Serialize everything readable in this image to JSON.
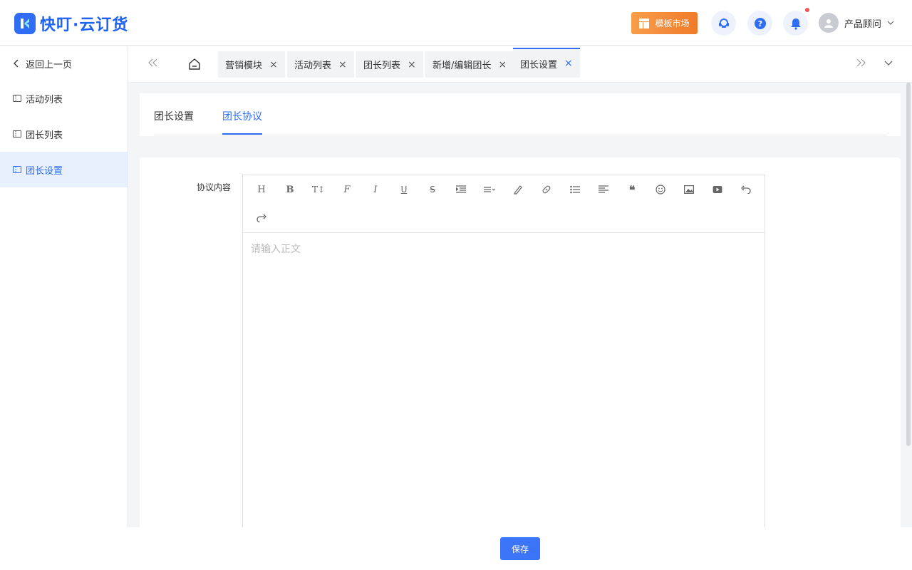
{
  "app": {
    "logo_text": "快叮·云订货"
  },
  "header": {
    "market_label": "模板市场",
    "user_name": "产品顾问"
  },
  "sidebar": {
    "back_label": "返回上一页",
    "items": [
      {
        "label": "活动列表"
      },
      {
        "label": "团长列表"
      },
      {
        "label": "团长设置"
      }
    ]
  },
  "tabs": [
    {
      "label": "营销模块"
    },
    {
      "label": "活动列表"
    },
    {
      "label": "团长列表"
    },
    {
      "label": "新增/编辑团长"
    },
    {
      "label": "团长设置"
    }
  ],
  "subtabs": [
    {
      "label": "团长设置"
    },
    {
      "label": "团长协议"
    }
  ],
  "form": {
    "field_label": "协议内容",
    "editor_placeholder": "请输入正文"
  },
  "footer": {
    "save_label": "保存"
  },
  "colors": {
    "primary": "#2f6df5",
    "accent_orange": "#f07b2b"
  }
}
